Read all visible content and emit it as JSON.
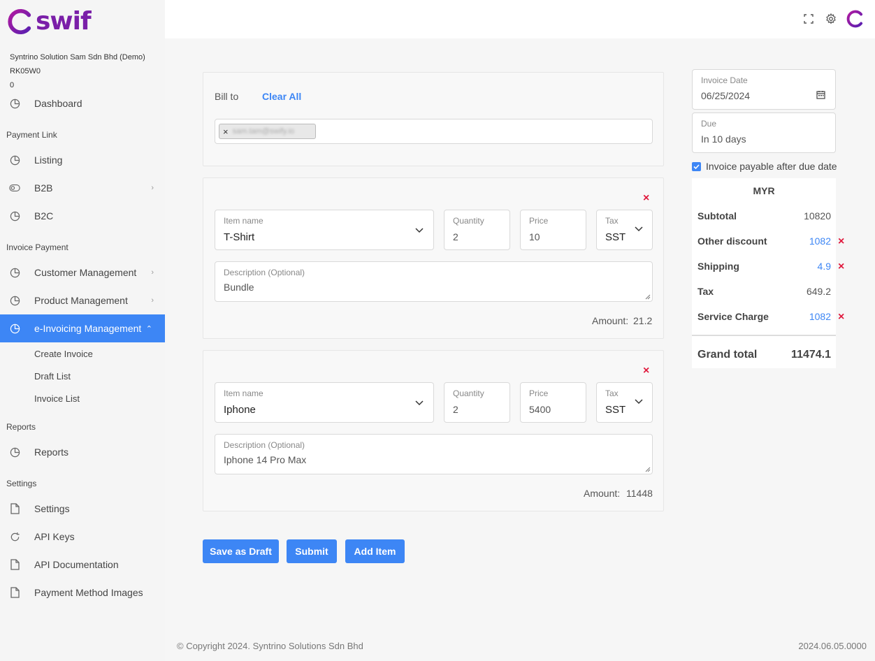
{
  "brand": {
    "name": "swif",
    "accent": "#3d86f5",
    "logo_color": "#7a1fa8",
    "danger": "#e0183c"
  },
  "company": {
    "name": "Syntrino Solution Sam Sdn Bhd (Demo)",
    "code": "RK05W0",
    "balance": "0"
  },
  "sidebar": {
    "dashboard": "Dashboard",
    "sections": {
      "payment_link": "Payment Link",
      "invoice_payment": "Invoice Payment",
      "reports": "Reports",
      "settings": "Settings"
    },
    "items": {
      "listing": "Listing",
      "b2b": "B2B",
      "b2c": "B2C",
      "customer_management": "Customer Management",
      "product_management": "Product Management",
      "einvoicing": "e-Invoicing Management",
      "create_invoice": "Create Invoice",
      "draft_list": "Draft List",
      "invoice_list": "Invoice List",
      "reports": "Reports",
      "settings": "Settings",
      "api_keys": "API Keys",
      "api_documentation": "API Documentation",
      "payment_method_images": "Payment Method Images"
    }
  },
  "bill_to": {
    "label": "Bill to",
    "clear_all": "Clear All",
    "tag_value": "sam.tam@swify.io",
    "tag_remove": "×"
  },
  "items": [
    {
      "name_label": "Item name",
      "name": "T-Shirt",
      "qty_label": "Quantity",
      "qty": "2",
      "price_label": "Price",
      "price": "10",
      "tax_label": "Tax",
      "tax": "SST",
      "desc_label": "Description (Optional)",
      "desc": "Bundle",
      "amount_label": "Amount:",
      "amount": "21.2",
      "remove": "×"
    },
    {
      "name_label": "Item name",
      "name": "Iphone",
      "qty_label": "Quantity",
      "qty": "2",
      "price_label": "Price",
      "price": "5400",
      "tax_label": "Tax",
      "tax": "SST",
      "desc_label": "Description (Optional)",
      "desc": "Iphone 14 Pro Max",
      "amount_label": "Amount:",
      "amount": "11448",
      "remove": "×"
    }
  ],
  "actions": {
    "save_draft": "Save as Draft",
    "submit": "Submit",
    "add_item": "Add Item"
  },
  "invoice_date": {
    "label": "Invoice Date",
    "value": "06/25/2024"
  },
  "due": {
    "label": "Due",
    "value": "In 10 days"
  },
  "payable_after_due": {
    "label": "Invoice payable after due date",
    "checked": true
  },
  "summary": {
    "currency": "MYR",
    "subtotal_label": "Subtotal",
    "subtotal": "10820",
    "discount_label": "Other discount",
    "discount": "1082",
    "shipping_label": "Shipping",
    "shipping": "4.9",
    "tax_label": "Tax",
    "tax": "649.2",
    "service_label": "Service Charge",
    "service": "1082",
    "grand_label": "Grand total",
    "grand": "11474.1",
    "remove": "×"
  },
  "footer": {
    "copyright": "© Copyright 2024. Syntrino Solutions Sdn Bhd",
    "version": "2024.06.05.0000"
  }
}
